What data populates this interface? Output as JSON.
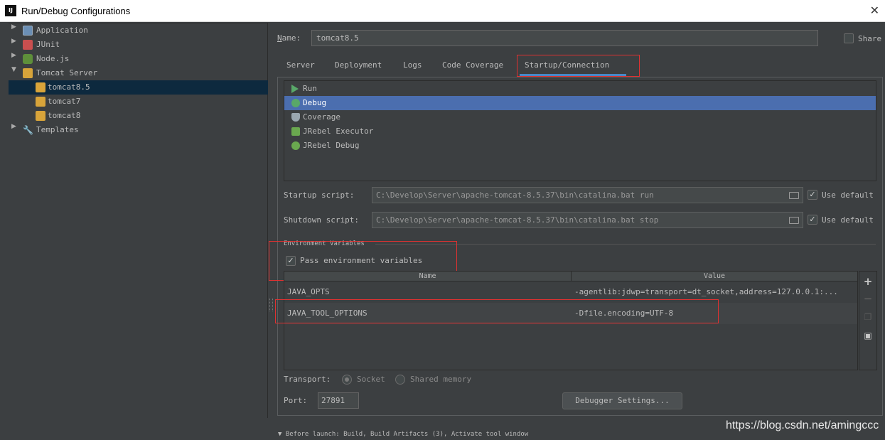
{
  "window": {
    "title": "Run/Debug Configurations",
    "logo": "IJ",
    "close_icon": "✕"
  },
  "tree": {
    "items": [
      {
        "label": "Application",
        "expanded": false
      },
      {
        "label": "JUnit",
        "expanded": false
      },
      {
        "label": "Node.js",
        "expanded": false
      },
      {
        "label": "Tomcat Server",
        "expanded": true
      },
      {
        "label": "tomcat8.5",
        "selected": true
      },
      {
        "label": "tomcat7"
      },
      {
        "label": "tomcat8"
      },
      {
        "label": "Templates",
        "expanded": false
      }
    ]
  },
  "name": {
    "label": "Name:",
    "value": "tomcat8.5"
  },
  "share": {
    "label": "Share",
    "checked": false
  },
  "tabs": [
    {
      "label": "Server"
    },
    {
      "label": "Deployment"
    },
    {
      "label": "Logs"
    },
    {
      "label": "Code Coverage"
    },
    {
      "label": "Startup/Connection",
      "active": true
    }
  ],
  "executors": [
    {
      "label": "Run",
      "icon": "play-icon"
    },
    {
      "label": "Debug",
      "icon": "bug-icon",
      "selected": true
    },
    {
      "label": "Coverage",
      "icon": "coverage-icon"
    },
    {
      "label": "JRebel Executor",
      "icon": "jrebel-icon"
    },
    {
      "label": "JRebel Debug",
      "icon": "jrebel-debug-icon"
    }
  ],
  "startup": {
    "label": "Startup script:",
    "value": "C:\\Develop\\Server\\apache-tomcat-8.5.37\\bin\\catalina.bat run",
    "use_default": "Use default"
  },
  "shutdown": {
    "label": "Shutdown script:",
    "value": "C:\\Develop\\Server\\apache-tomcat-8.5.37\\bin\\catalina.bat stop",
    "use_default": "Use default"
  },
  "env": {
    "title": "Environment Variables",
    "pass_label": "Pass environment variables",
    "pass_checked": true,
    "columns": [
      "Name",
      "Value"
    ],
    "rows": [
      {
        "name": "JAVA_OPTS",
        "value": "-agentlib:jdwp=transport=dt_socket,address=127.0.0.1:..."
      },
      {
        "name": "JAVA_TOOL_OPTIONS",
        "value": "-Dfile.encoding=UTF-8"
      }
    ]
  },
  "transport": {
    "label": "Transport:",
    "socket": "Socket",
    "shared": "Shared memory"
  },
  "port": {
    "label": "Port:",
    "value": "27891"
  },
  "debugger_settings": "Debugger Settings...",
  "before_launch": "Before launch: Build, Build Artifacts (3), Activate tool window",
  "watermark": "https://blog.csdn.net/amingccc",
  "colors": {
    "accent": "#4b6eaf",
    "highlight_box": "#e03131",
    "selection": "#0d293e"
  }
}
